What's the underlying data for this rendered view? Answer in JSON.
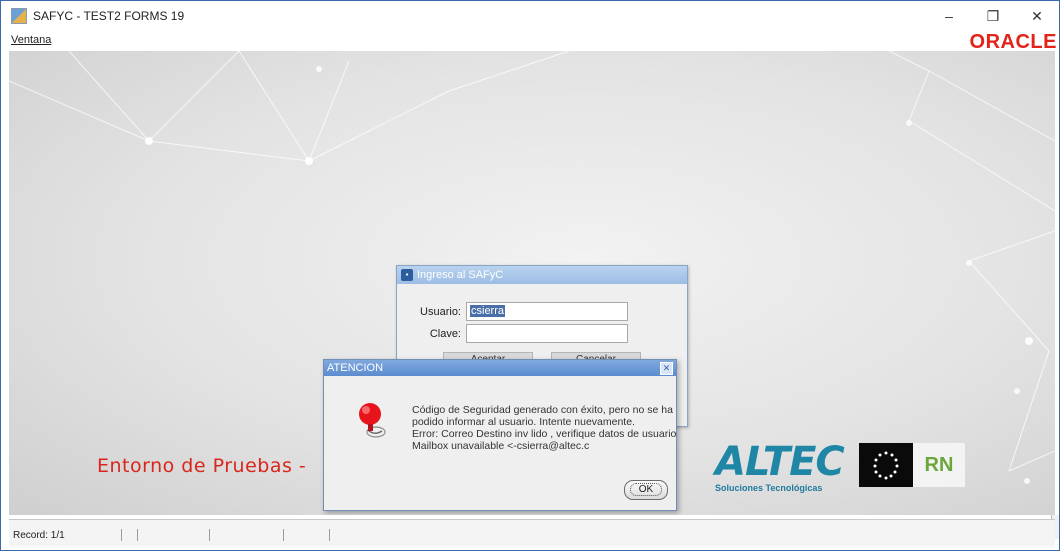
{
  "window": {
    "title": "SAFYC - TEST2 FORMS 19",
    "controls": {
      "minimize": "–",
      "restore": "❐",
      "close": "✕"
    }
  },
  "menubar": {
    "items": [
      {
        "label": "Ventana"
      }
    ]
  },
  "brand": {
    "oracle": "ORACLE",
    "oracle_color": "#e2231a"
  },
  "workspace": {
    "environment_label": "Entorno de Pruebas -",
    "logos": {
      "altec_word": "ALTEC",
      "altec_sub": "Soluciones Tecnológicas",
      "rn": "RN"
    }
  },
  "login_dialog": {
    "title": "Ingreso al SAFyC",
    "user_label": "Usuario:",
    "user_value": "csierra",
    "password_label": "Clave:",
    "password_value": "",
    "accept_label": "Aceptar",
    "cancel_label": "Cancelar"
  },
  "alert_dialog": {
    "title": "ATENCION",
    "icon": "alert-bell-icon",
    "message_lines": [
      "Código de Seguridad generado con  éxito, pero no se ha",
      "podido informar al usuario. Intente nuevamente.",
      "Error: Correo Destino inv lido , verifique datos de usuario",
      "Mailbox unavailable <-csierra@altec.c"
    ],
    "ok_label": "OK"
  },
  "statusbar": {
    "record": "Record: 1/1"
  }
}
